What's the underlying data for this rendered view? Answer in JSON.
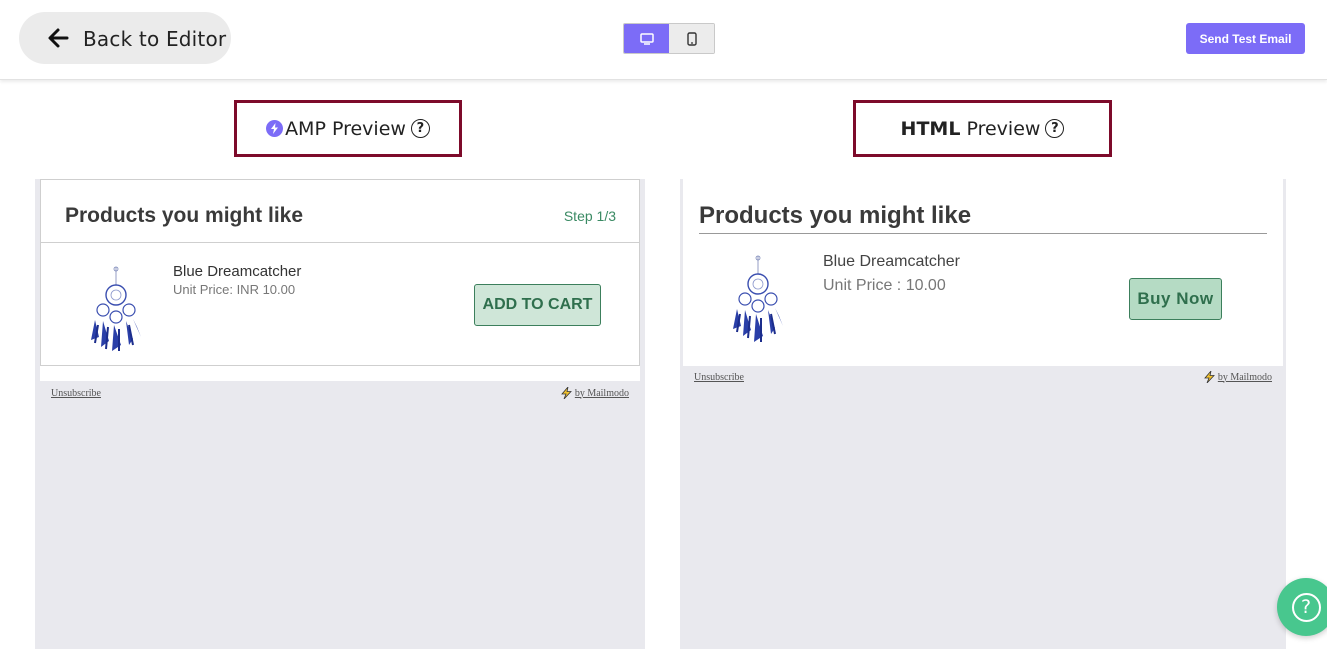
{
  "topbar": {
    "back_label": "Back to Editor",
    "view_toggle": {
      "options": [
        "desktop-icon",
        "mobile-icon"
      ],
      "active": "desktop"
    },
    "send_label": "Send Test Email"
  },
  "amp_preview": {
    "label_prefix": "AMP",
    "label_suffix": " Preview",
    "help": "?",
    "card": {
      "title": "Products you might like",
      "step": "Step 1/3",
      "product_name": "Blue Dreamcatcher",
      "product_price": "Unit Price: INR 10.00",
      "cta": "ADD TO CART"
    },
    "footer": {
      "unsubscribe": "Unsubscribe",
      "by": "by Mailmodo"
    }
  },
  "html_preview": {
    "label_prefix": "HTML",
    "label_suffix": " Preview",
    "help": "?",
    "card": {
      "title": "Products you might like",
      "product_name": "Blue Dreamcatcher",
      "product_price": "Unit Price : 10.00",
      "cta": "Buy Now"
    },
    "footer": {
      "unsubscribe": "Unsubscribe",
      "by": "by Mailmodo"
    }
  },
  "help_fab": {
    "icon": "?"
  },
  "colors": {
    "accent": "#7c6cf7",
    "highlight_border": "#7d0a2a",
    "cta_green": "#2f6f4d",
    "fab": "#48c78e"
  }
}
